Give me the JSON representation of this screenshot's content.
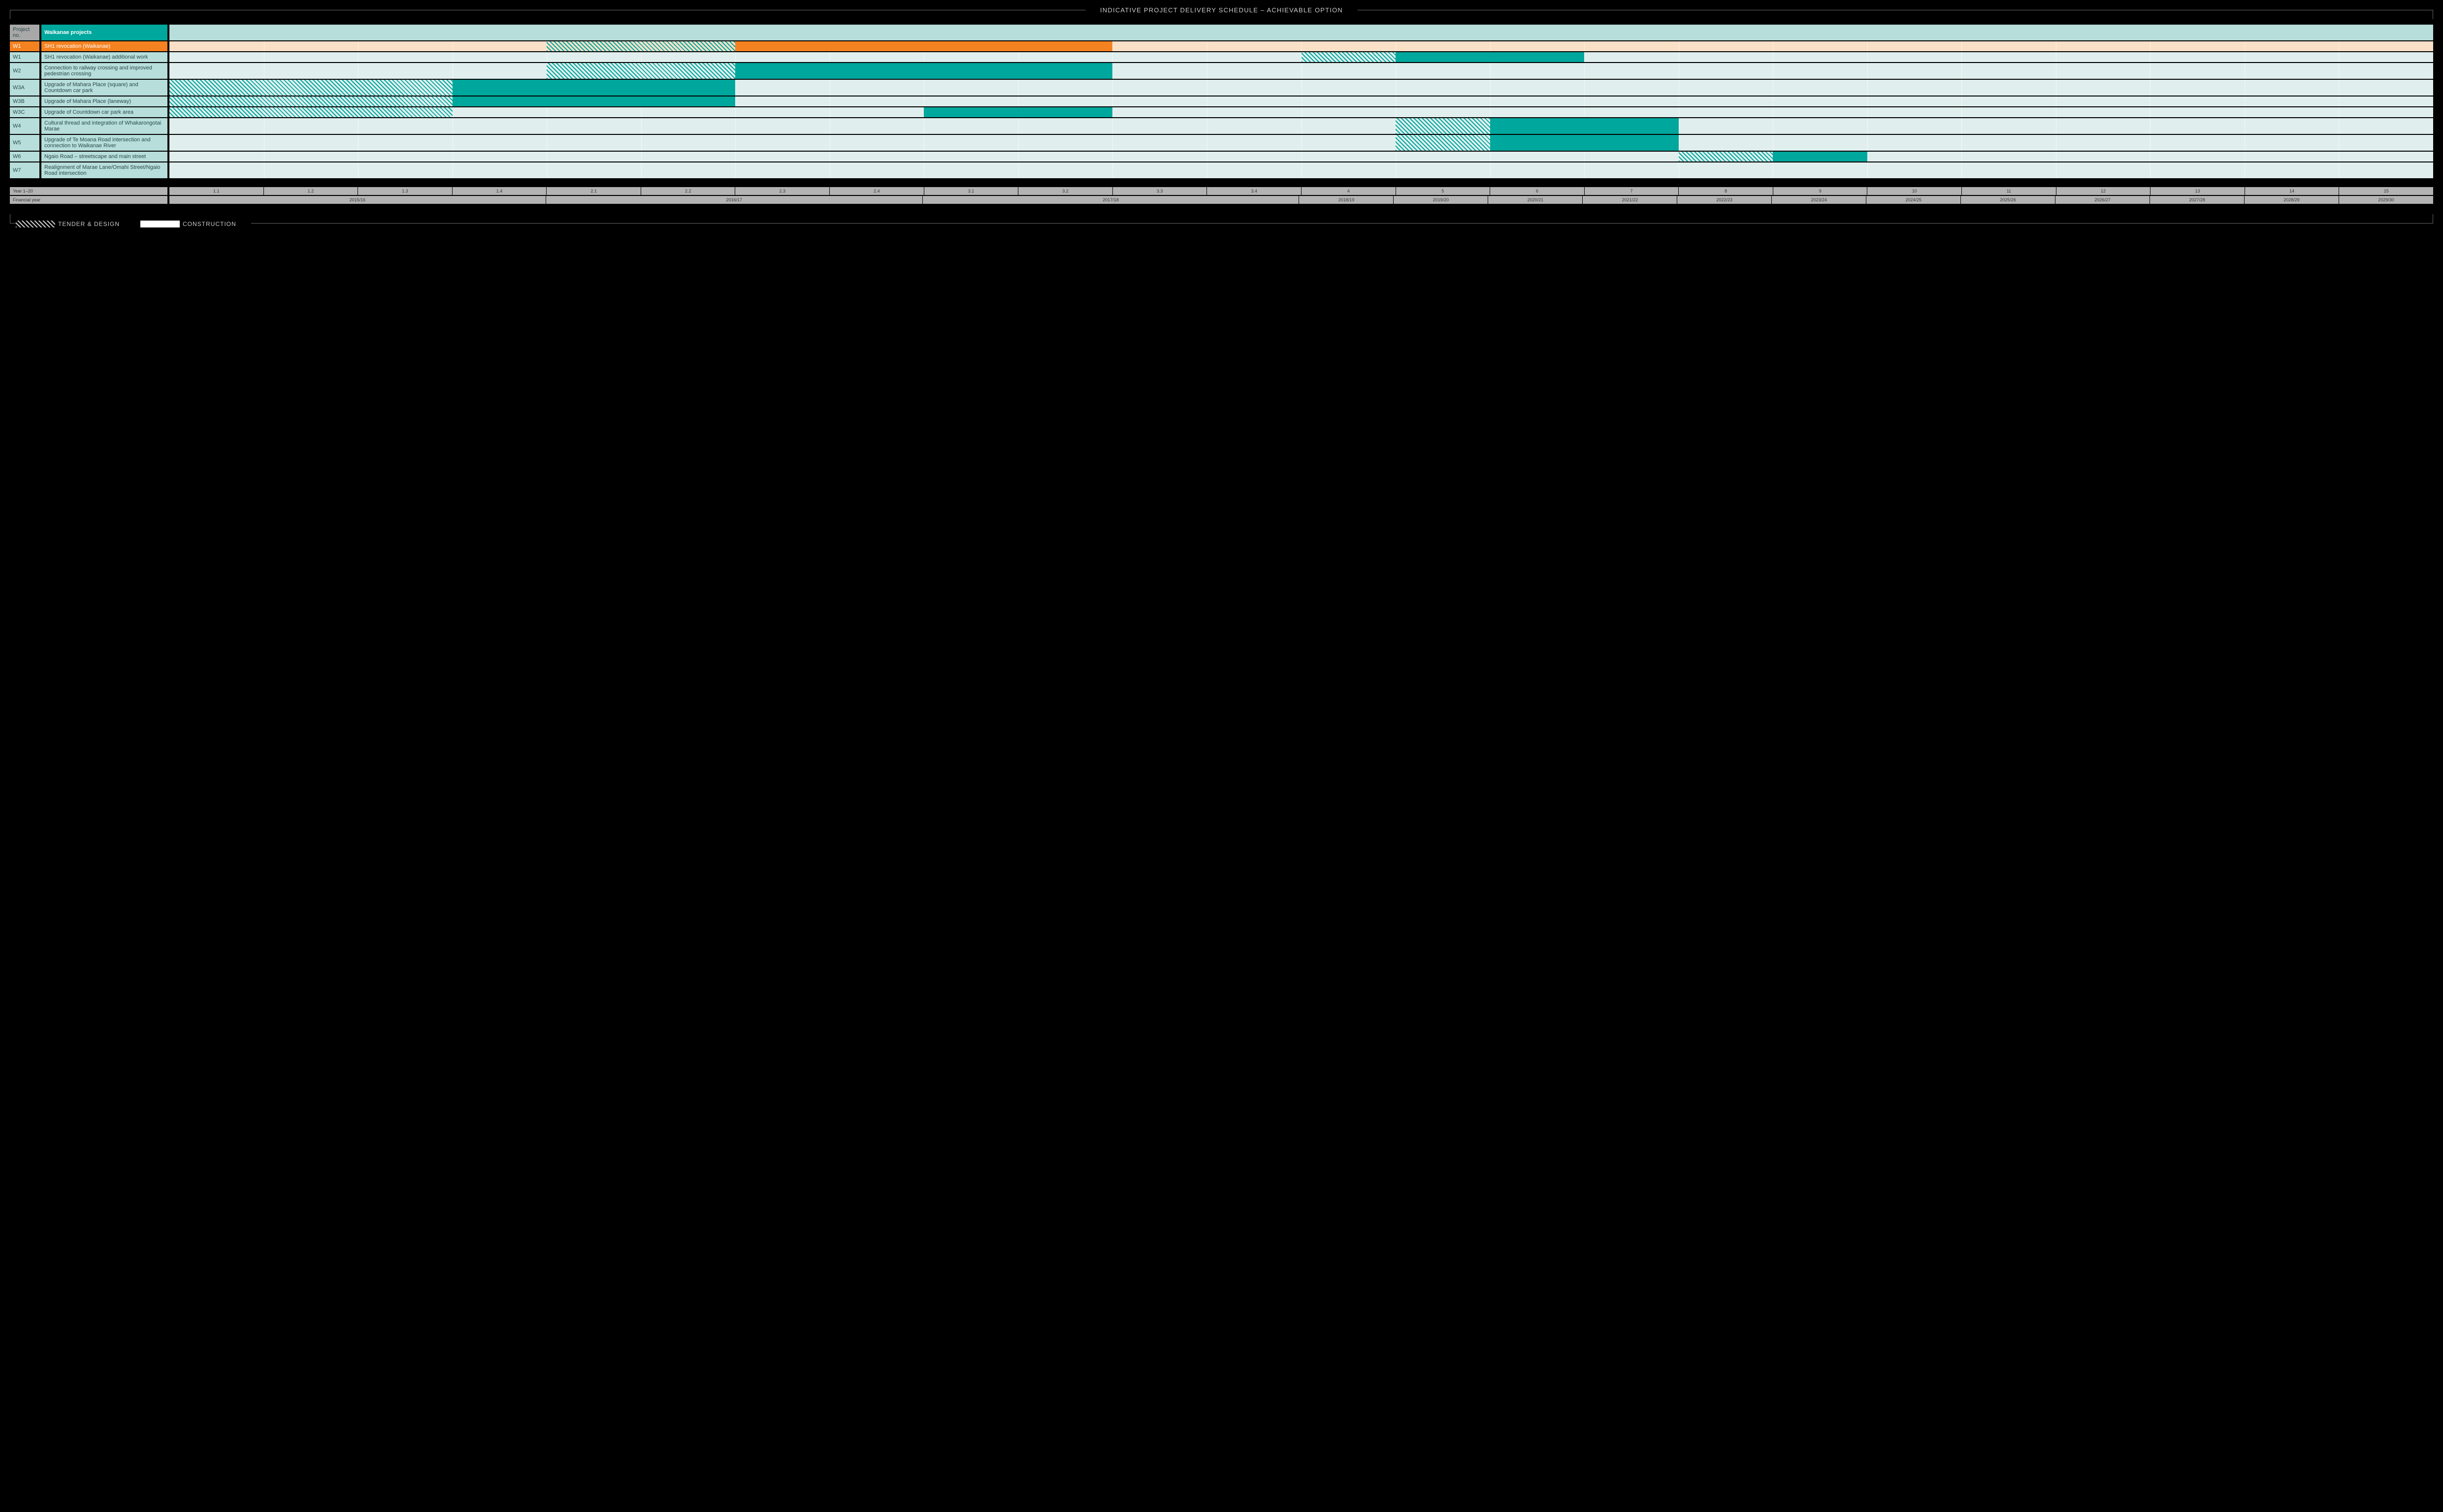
{
  "title": "INDICATIVE PROJECT DELIVERY SCHEDULE – ACHIEVABLE OPTION",
  "column_headers": {
    "project_no": "Project no.",
    "project_group": "Waikanae projects"
  },
  "legend": {
    "tender_design": "TENDER & DESIGN",
    "construction": "CONSTRUCTION"
  },
  "axis": {
    "year_label": "Year 1–20",
    "financial_year_label": "Financial year",
    "year_ticks": [
      "1.1",
      "1.2",
      "1.3",
      "1.4",
      "2.1",
      "2.2",
      "2.3",
      "2.4",
      "3.1",
      "3.2",
      "3.3",
      "3.4",
      "4",
      "5",
      "6",
      "7",
      "8",
      "9",
      "10",
      "11",
      "12",
      "13",
      "14",
      "15"
    ],
    "financial_years": [
      "2015/16",
      "2016/17",
      "2017/18",
      "2018/19",
      "2019/20",
      "2020/21",
      "2021/22",
      "2022/23",
      "2023/24",
      "2024/25",
      "2025/26",
      "2026/27",
      "2027/28",
      "2028/29",
      "2029/30"
    ],
    "fy_spans": [
      4,
      4,
      4,
      1,
      1,
      1,
      1,
      1,
      1,
      1,
      1,
      1,
      1,
      1,
      1
    ]
  },
  "chart_data": {
    "type": "bar",
    "title": "Indicative Project Delivery Schedule – Achievable Option (Waikanae projects)",
    "xlabel": "Year 1–20 quarters / financial years",
    "ylabel": "Project",
    "x_ticks": [
      "1.1",
      "1.2",
      "1.3",
      "1.4",
      "2.1",
      "2.2",
      "2.3",
      "2.4",
      "3.1",
      "3.2",
      "3.3",
      "3.4",
      "4",
      "5",
      "6",
      "7",
      "8",
      "9",
      "10",
      "11",
      "12",
      "13",
      "14",
      "15"
    ],
    "rows": [
      {
        "id": "W1",
        "name": "SH1 revocation (Waikanae)",
        "style": "orange",
        "bars": [
          {
            "type": "tender_design",
            "start_col": 4,
            "span_cols": 2
          },
          {
            "type": "construction_orange",
            "start_col": 6,
            "span_cols": 4
          }
        ]
      },
      {
        "id": "W1",
        "name": "SH1 revocation (Waikanae) additional work",
        "style": "ltteal",
        "bars": [
          {
            "type": "tender_design",
            "start_col": 12,
            "span_cols": 1
          },
          {
            "type": "construction_teal",
            "start_col": 13,
            "span_cols": 2
          }
        ]
      },
      {
        "id": "W2",
        "name": "Connection to railway crossing and improved pedestrian crossing",
        "style": "ltteal",
        "bars": [
          {
            "type": "tender_design",
            "start_col": 4,
            "span_cols": 2
          },
          {
            "type": "construction_teal",
            "start_col": 6,
            "span_cols": 4
          }
        ]
      },
      {
        "id": "W3A",
        "name": "Upgrade of Mahara Place (square) and Countdown car park",
        "style": "ltteal",
        "bars": [
          {
            "type": "tender_design",
            "start_col": 0,
            "span_cols": 3
          },
          {
            "type": "construction_teal",
            "start_col": 3,
            "span_cols": 3
          }
        ]
      },
      {
        "id": "W3B",
        "name": "Upgrade of Mahara Place (laneway)",
        "style": "ltteal",
        "bars": [
          {
            "type": "tender_design",
            "start_col": 0,
            "span_cols": 3
          },
          {
            "type": "construction_teal",
            "start_col": 3,
            "span_cols": 3
          }
        ]
      },
      {
        "id": "W3C",
        "name": "Upgrade of Countdown car park area",
        "style": "ltteal",
        "bars": [
          {
            "type": "tender_design",
            "start_col": 0,
            "span_cols": 3
          },
          {
            "type": "construction_teal",
            "start_col": 8,
            "span_cols": 2
          }
        ]
      },
      {
        "id": "W4",
        "name": "Cultural thread and integration of Whakarongotai Marae",
        "style": "ltteal",
        "bars": [
          {
            "type": "tender_design",
            "start_col": 13,
            "span_cols": 1
          },
          {
            "type": "construction_teal",
            "start_col": 14,
            "span_cols": 2
          }
        ]
      },
      {
        "id": "W5",
        "name": "Upgrade of Te Moana Road intersection and connection to Waikanae River",
        "style": "ltteal",
        "bars": [
          {
            "type": "tender_design",
            "start_col": 13,
            "span_cols": 1
          },
          {
            "type": "construction_teal",
            "start_col": 14,
            "span_cols": 2
          }
        ]
      },
      {
        "id": "W6",
        "name": "Ngaio Road – streetscape and main street",
        "style": "ltteal",
        "bars": [
          {
            "type": "tender_design",
            "start_col": 16,
            "span_cols": 1
          },
          {
            "type": "construction_teal",
            "start_col": 17,
            "span_cols": 1
          }
        ]
      },
      {
        "id": "W7",
        "name": "Realignment of Marae Lane/Omahi Street/Ngaio Road intersection",
        "style": "ltteal",
        "bars": []
      }
    ]
  }
}
